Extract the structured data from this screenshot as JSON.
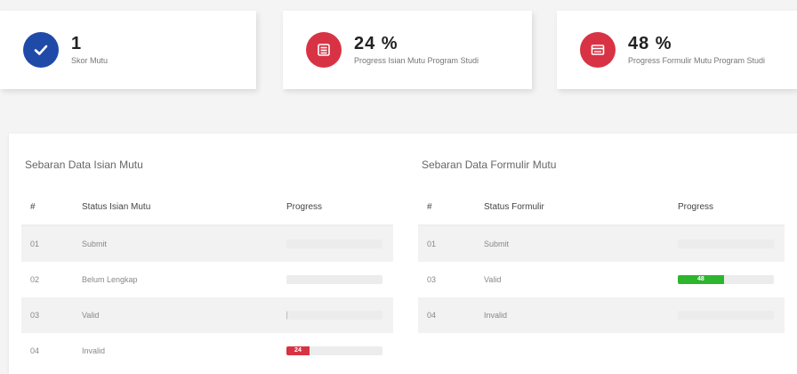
{
  "cards": [
    {
      "value": "1",
      "label": "Skor Mutu",
      "icon": "check-icon",
      "color": "#1f4aa8"
    },
    {
      "value": "24 %",
      "label": "Progress Isian Mutu Program Studi",
      "icon": "list-icon",
      "color": "#d83344"
    },
    {
      "value": "48 %",
      "label": "Progress Formulir Mutu Program Studi",
      "icon": "form-icon",
      "color": "#d83344"
    }
  ],
  "isian": {
    "title": "Sebaran Data Isian Mutu",
    "headers": [
      "#",
      "Status Isian Mutu",
      "Progress"
    ],
    "rows": [
      {
        "no": "01",
        "status": "Submit",
        "progress": 0,
        "label": "",
        "color": "#cccccc"
      },
      {
        "no": "02",
        "status": "Belum Lengkap",
        "progress": 0,
        "label": "",
        "color": "#cccccc"
      },
      {
        "no": "03",
        "status": "Valid",
        "progress": 0.01,
        "label": "",
        "color": "#bbbbbb"
      },
      {
        "no": "04",
        "status": "Invalid",
        "progress": 0.24,
        "label": "24",
        "color": "#d83344"
      }
    ]
  },
  "formulir": {
    "title": "Sebaran Data Formulir Mutu",
    "headers": [
      "#",
      "Status Formulir",
      "Progress"
    ],
    "rows": [
      {
        "no": "01",
        "status": "Submit",
        "progress": 0,
        "label": "",
        "color": "#cccccc"
      },
      {
        "no": "03",
        "status": "Valid",
        "progress": 0.48,
        "label": "48",
        "color": "#2eb52e"
      },
      {
        "no": "04",
        "status": "Invalid",
        "progress": 0,
        "label": "",
        "color": "#cccccc"
      }
    ]
  }
}
